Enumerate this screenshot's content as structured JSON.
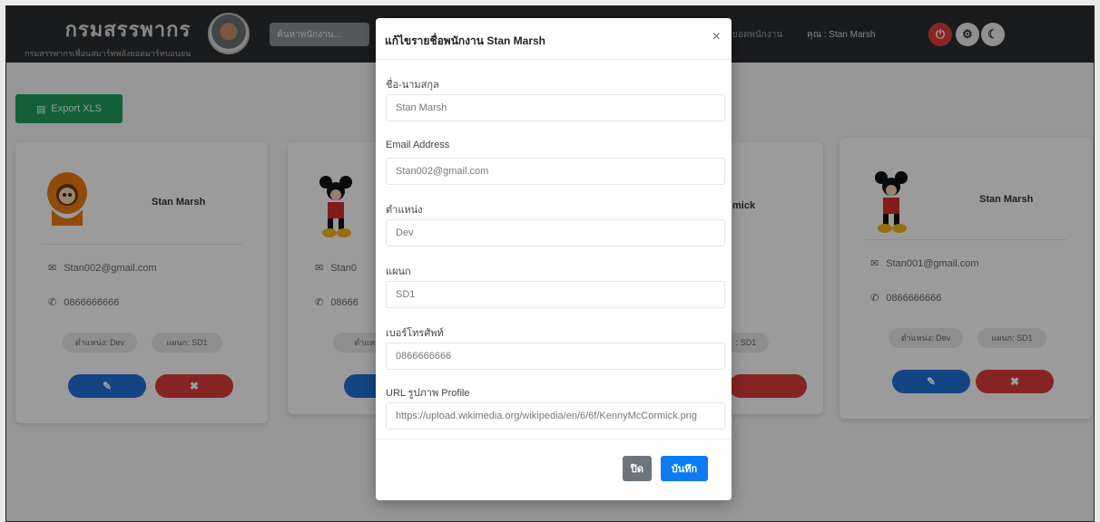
{
  "navbar": {
    "brand_title": "กรมสรรพากร",
    "brand_subtitle": "กรมสรรพากรเพื่อนสมาร์ทพลังยอดมาร์ทบอนยน",
    "search_placeholder": "ค้นหาพนักงาน...",
    "link_text": "ยอดพนักงาน",
    "user_text": "คุณ : Stan Marsh",
    "btn_red_icon": "power-icon",
    "btn_settings_icon": "gear-icon",
    "btn_moon_icon": "moon-icon"
  },
  "toolbar": {
    "export_label": "Export XLS"
  },
  "cards": [
    {
      "name": "Stan Marsh",
      "email": "Stan002@gmail.com",
      "phone": "0866666666",
      "position_badge": "ตำแหน่ง: Dev",
      "dept_badge": "แผนก: SD1",
      "edit_icon": "✎",
      "delete_icon": "✖"
    },
    {
      "name": "",
      "email": "Stan0",
      "phone": "08666",
      "position_badge": "ตำแหน่ง",
      "dept_badge": "",
      "edit_icon": "",
      "delete_icon": ""
    },
    {
      "name": "mick",
      "email": "",
      "phone": "",
      "position_badge": "",
      "dept_badge": ": SD1",
      "edit_icon": "",
      "delete_icon": ""
    },
    {
      "name": "Stan Marsh",
      "email": "Stan001@gmail.com",
      "phone": "0866666666",
      "position_badge": "ตำแหน่ง: Dev",
      "dept_badge": "แผนก: SD1",
      "edit_icon": "✎",
      "delete_icon": "✖"
    }
  ],
  "modal": {
    "title": "แก้ไขรายชื่อพนักงาน Stan Marsh",
    "close_icon": "×",
    "fields": [
      {
        "label": "ชื่อ-นามสกุล",
        "value": "Stan Marsh"
      },
      {
        "label": "Email Address",
        "value": "Stan002@gmail.com"
      },
      {
        "label": "ตำแหน่ง",
        "value": "Dev"
      },
      {
        "label": "แผนก",
        "value": "SD1"
      },
      {
        "label": "เบอร์โทรศัพท์",
        "value": "0866666666"
      },
      {
        "label": "URL รูปภาพ Profile",
        "value": "https://upload.wikimedia.org/wikipedia/en/6/6f/KennyMcCormick.png"
      }
    ],
    "close_button": "ปิด",
    "save_button": "บันทึก"
  },
  "colors": {
    "navbar": "#2b2d30",
    "export": "#1f9b5a",
    "edit": "#1f6fd6",
    "delete": "#d93a3a",
    "save": "#0d7bf2"
  }
}
